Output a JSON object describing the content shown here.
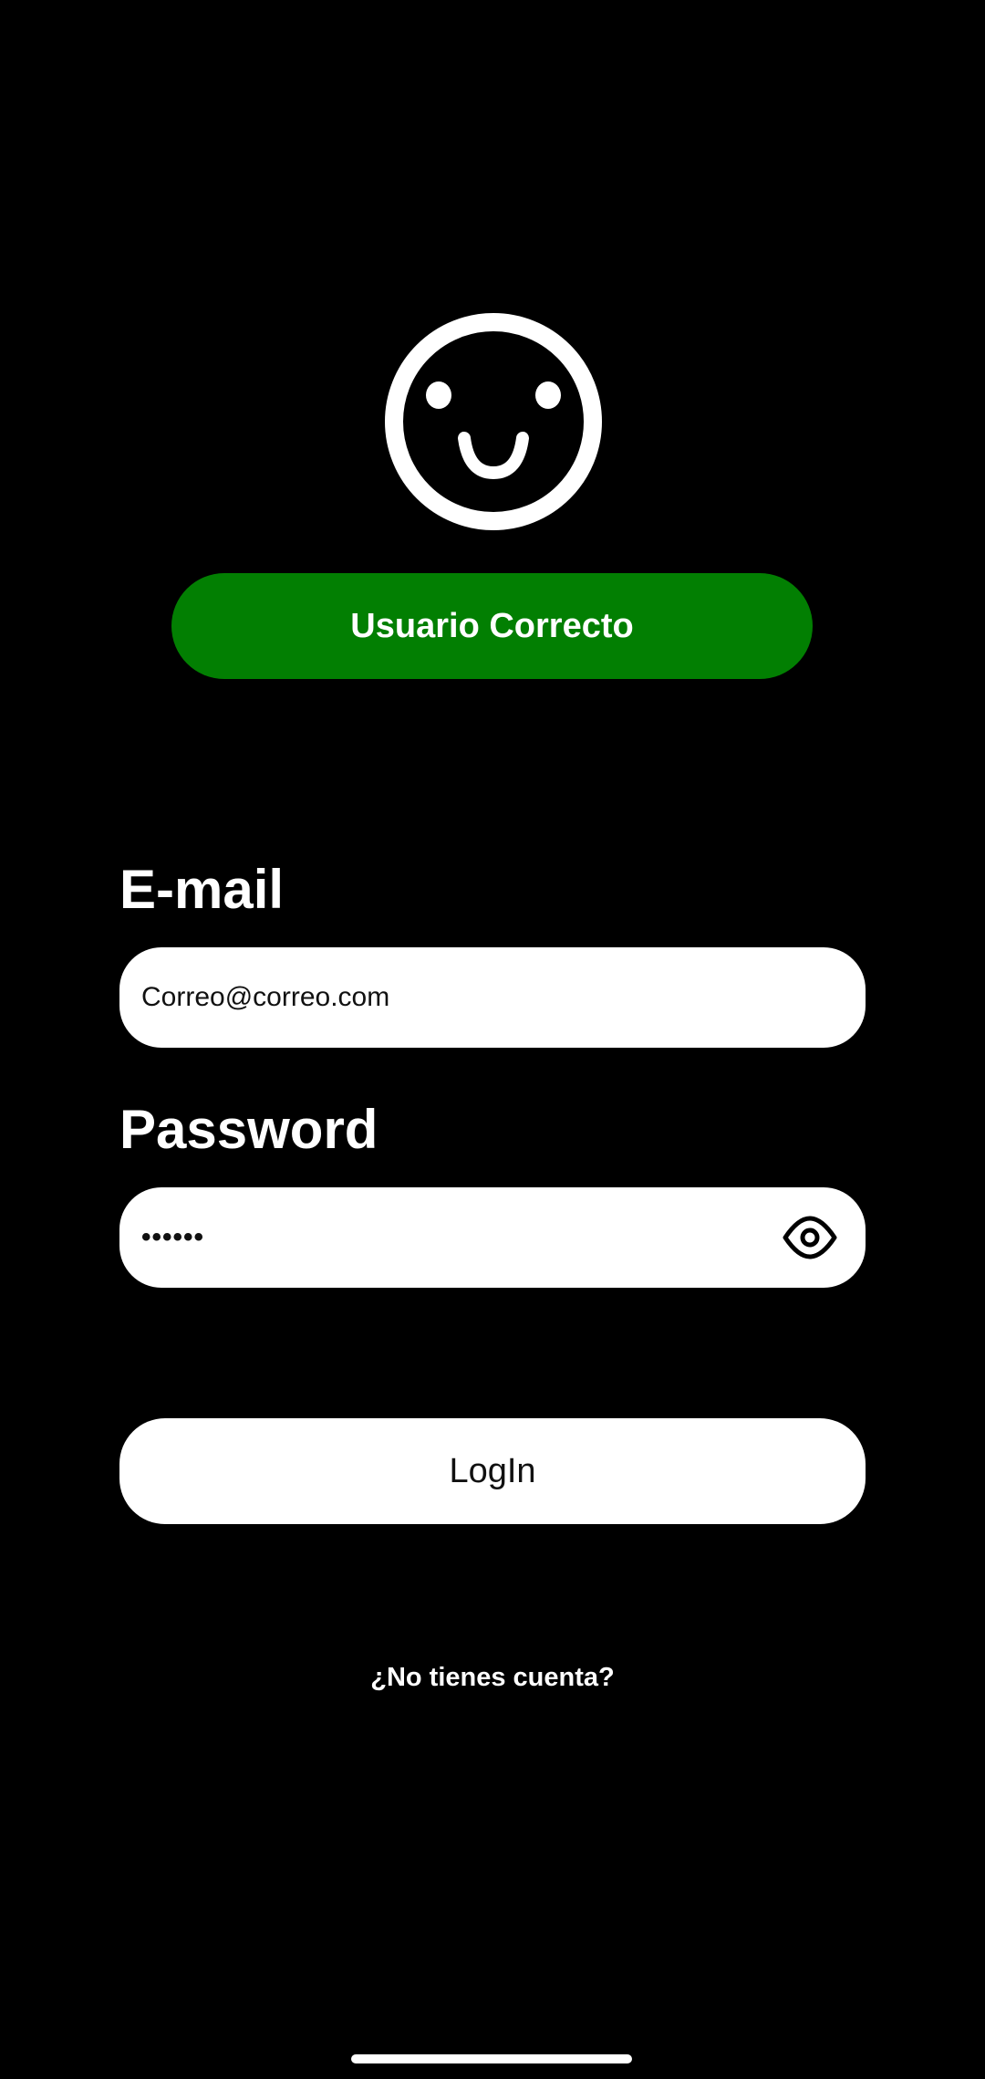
{
  "status_badge": {
    "label": "Usuario Correcto",
    "color": "#027f02"
  },
  "avatar": {
    "icon": "smiley-face-icon"
  },
  "email": {
    "label": "E-mail",
    "value": "Correo@correo.com"
  },
  "password": {
    "label": "Password",
    "value": "••••••",
    "toggle_icon": "eye-icon"
  },
  "login_button": {
    "label": "LogIn"
  },
  "signup_link": {
    "label": "¿No tienes cuenta?"
  }
}
